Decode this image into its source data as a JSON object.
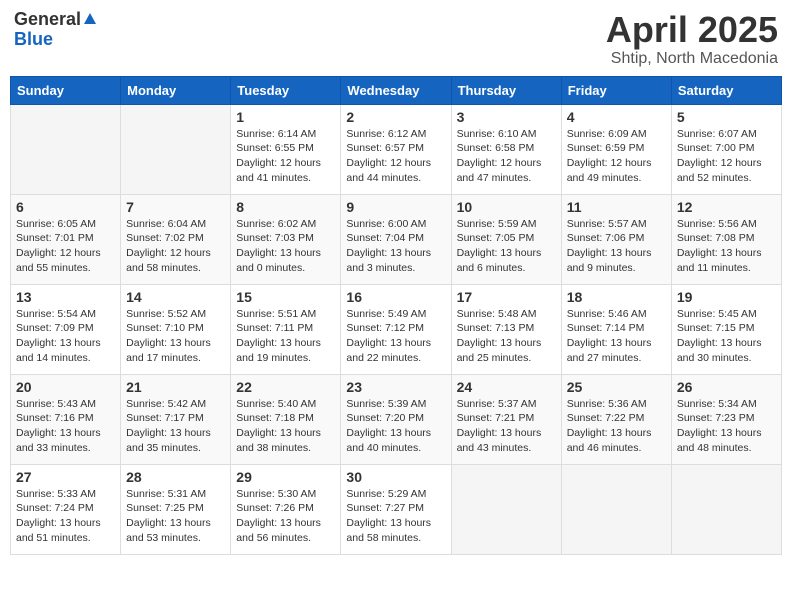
{
  "header": {
    "logo_general": "General",
    "logo_blue": "Blue",
    "month": "April 2025",
    "location": "Shtip, North Macedonia"
  },
  "weekdays": [
    "Sunday",
    "Monday",
    "Tuesday",
    "Wednesday",
    "Thursday",
    "Friday",
    "Saturday"
  ],
  "weeks": [
    [
      {
        "day": "",
        "detail": ""
      },
      {
        "day": "",
        "detail": ""
      },
      {
        "day": "1",
        "detail": "Sunrise: 6:14 AM\nSunset: 6:55 PM\nDaylight: 12 hours\nand 41 minutes."
      },
      {
        "day": "2",
        "detail": "Sunrise: 6:12 AM\nSunset: 6:57 PM\nDaylight: 12 hours\nand 44 minutes."
      },
      {
        "day": "3",
        "detail": "Sunrise: 6:10 AM\nSunset: 6:58 PM\nDaylight: 12 hours\nand 47 minutes."
      },
      {
        "day": "4",
        "detail": "Sunrise: 6:09 AM\nSunset: 6:59 PM\nDaylight: 12 hours\nand 49 minutes."
      },
      {
        "day": "5",
        "detail": "Sunrise: 6:07 AM\nSunset: 7:00 PM\nDaylight: 12 hours\nand 52 minutes."
      }
    ],
    [
      {
        "day": "6",
        "detail": "Sunrise: 6:05 AM\nSunset: 7:01 PM\nDaylight: 12 hours\nand 55 minutes."
      },
      {
        "day": "7",
        "detail": "Sunrise: 6:04 AM\nSunset: 7:02 PM\nDaylight: 12 hours\nand 58 minutes."
      },
      {
        "day": "8",
        "detail": "Sunrise: 6:02 AM\nSunset: 7:03 PM\nDaylight: 13 hours\nand 0 minutes."
      },
      {
        "day": "9",
        "detail": "Sunrise: 6:00 AM\nSunset: 7:04 PM\nDaylight: 13 hours\nand 3 minutes."
      },
      {
        "day": "10",
        "detail": "Sunrise: 5:59 AM\nSunset: 7:05 PM\nDaylight: 13 hours\nand 6 minutes."
      },
      {
        "day": "11",
        "detail": "Sunrise: 5:57 AM\nSunset: 7:06 PM\nDaylight: 13 hours\nand 9 minutes."
      },
      {
        "day": "12",
        "detail": "Sunrise: 5:56 AM\nSunset: 7:08 PM\nDaylight: 13 hours\nand 11 minutes."
      }
    ],
    [
      {
        "day": "13",
        "detail": "Sunrise: 5:54 AM\nSunset: 7:09 PM\nDaylight: 13 hours\nand 14 minutes."
      },
      {
        "day": "14",
        "detail": "Sunrise: 5:52 AM\nSunset: 7:10 PM\nDaylight: 13 hours\nand 17 minutes."
      },
      {
        "day": "15",
        "detail": "Sunrise: 5:51 AM\nSunset: 7:11 PM\nDaylight: 13 hours\nand 19 minutes."
      },
      {
        "day": "16",
        "detail": "Sunrise: 5:49 AM\nSunset: 7:12 PM\nDaylight: 13 hours\nand 22 minutes."
      },
      {
        "day": "17",
        "detail": "Sunrise: 5:48 AM\nSunset: 7:13 PM\nDaylight: 13 hours\nand 25 minutes."
      },
      {
        "day": "18",
        "detail": "Sunrise: 5:46 AM\nSunset: 7:14 PM\nDaylight: 13 hours\nand 27 minutes."
      },
      {
        "day": "19",
        "detail": "Sunrise: 5:45 AM\nSunset: 7:15 PM\nDaylight: 13 hours\nand 30 minutes."
      }
    ],
    [
      {
        "day": "20",
        "detail": "Sunrise: 5:43 AM\nSunset: 7:16 PM\nDaylight: 13 hours\nand 33 minutes."
      },
      {
        "day": "21",
        "detail": "Sunrise: 5:42 AM\nSunset: 7:17 PM\nDaylight: 13 hours\nand 35 minutes."
      },
      {
        "day": "22",
        "detail": "Sunrise: 5:40 AM\nSunset: 7:18 PM\nDaylight: 13 hours\nand 38 minutes."
      },
      {
        "day": "23",
        "detail": "Sunrise: 5:39 AM\nSunset: 7:20 PM\nDaylight: 13 hours\nand 40 minutes."
      },
      {
        "day": "24",
        "detail": "Sunrise: 5:37 AM\nSunset: 7:21 PM\nDaylight: 13 hours\nand 43 minutes."
      },
      {
        "day": "25",
        "detail": "Sunrise: 5:36 AM\nSunset: 7:22 PM\nDaylight: 13 hours\nand 46 minutes."
      },
      {
        "day": "26",
        "detail": "Sunrise: 5:34 AM\nSunset: 7:23 PM\nDaylight: 13 hours\nand 48 minutes."
      }
    ],
    [
      {
        "day": "27",
        "detail": "Sunrise: 5:33 AM\nSunset: 7:24 PM\nDaylight: 13 hours\nand 51 minutes."
      },
      {
        "day": "28",
        "detail": "Sunrise: 5:31 AM\nSunset: 7:25 PM\nDaylight: 13 hours\nand 53 minutes."
      },
      {
        "day": "29",
        "detail": "Sunrise: 5:30 AM\nSunset: 7:26 PM\nDaylight: 13 hours\nand 56 minutes."
      },
      {
        "day": "30",
        "detail": "Sunrise: 5:29 AM\nSunset: 7:27 PM\nDaylight: 13 hours\nand 58 minutes."
      },
      {
        "day": "",
        "detail": ""
      },
      {
        "day": "",
        "detail": ""
      },
      {
        "day": "",
        "detail": ""
      }
    ]
  ]
}
